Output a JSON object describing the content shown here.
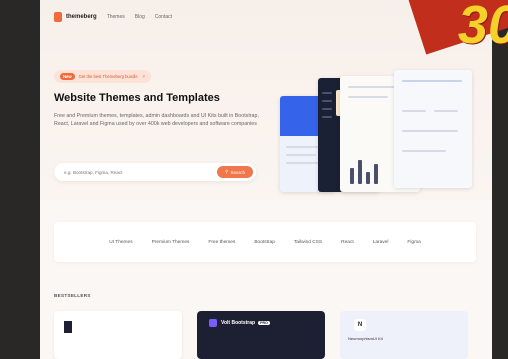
{
  "brand": {
    "name": "themeberg",
    "accent": "#f06a3b"
  },
  "nav": {
    "links": [
      "Themes",
      "Blog",
      "Contact"
    ]
  },
  "hero": {
    "pill_tag": "New",
    "pill_text": "Get the best Themeberg bundle",
    "title": "Website Themes and Templates",
    "subtitle": "Free and Premium themes, templates, admin dashboards and UI Kits built in Bootstrap, React, Laravel and Figma used by over 400k web developers and software companies",
    "search_placeholder": "e.g. Bootstrap, Figma, React",
    "search_button": "Search"
  },
  "categories": [
    "UI Themes",
    "Premium Themes",
    "Free themes",
    "Bootstrap",
    "Tailwind CSS",
    "React",
    "Laravel",
    "Figma"
  ],
  "section": {
    "title": "BESTSELLERS"
  },
  "cards": [
    {
      "title": "",
      "badge": ""
    },
    {
      "title": "Volt Bootstrap",
      "badge": "PRO"
    },
    {
      "title": "NeumorphismUI Kit",
      "badge": ""
    }
  ],
  "card3_logo": "N",
  "promo": {
    "text": "30",
    "color": "#f6d12a"
  }
}
